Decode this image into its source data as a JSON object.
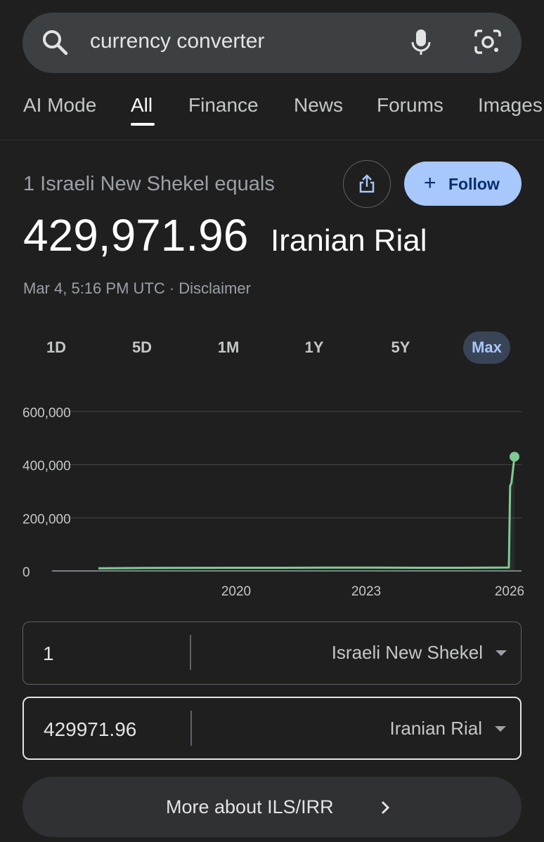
{
  "search": {
    "query": "currency converter"
  },
  "tabs": [
    "AI Mode",
    "All",
    "Finance",
    "News",
    "Forums",
    "Images"
  ],
  "header": {
    "equals_label": "1 Israeli New Shekel equals",
    "value": "429,971.96",
    "unit": "Iranian Rial",
    "timestamp": "Mar 4, 5:16 PM UTC · Disclaimer",
    "follow_label": "Follow"
  },
  "ranges": [
    "1D",
    "5D",
    "1M",
    "1Y",
    "5Y",
    "Max"
  ],
  "active_range": "Max",
  "converter": {
    "from_amount": "1",
    "from_currency": "Israeli New Shekel",
    "to_amount": "429971.96",
    "to_currency": "Iranian Rial"
  },
  "more_label": "More about ILS/IRR",
  "colors": {
    "line": "#81c995",
    "accent": "#a8c7fa"
  },
  "chart_data": {
    "type": "line",
    "ylim": [
      0,
      600000
    ],
    "yticks": [
      0,
      200000,
      400000,
      600000
    ],
    "ytick_labels": [
      "0",
      "200,000",
      "400,000",
      "600,000"
    ],
    "xticks": [
      2020,
      2023,
      2026
    ],
    "xtick_labels": [
      "2020",
      "2023",
      "2026"
    ],
    "x": [
      2017.0,
      2018.0,
      2019.0,
      2020.0,
      2021.0,
      2022.0,
      2023.0,
      2024.0,
      2025.0,
      2025.95,
      2026.0,
      2026.05,
      2026.17
    ],
    "values": [
      10000,
      11000,
      11500,
      12000,
      12000,
      12500,
      12500,
      12000,
      12000,
      13000,
      320000,
      330000,
      429971.96
    ],
    "grid": true
  }
}
